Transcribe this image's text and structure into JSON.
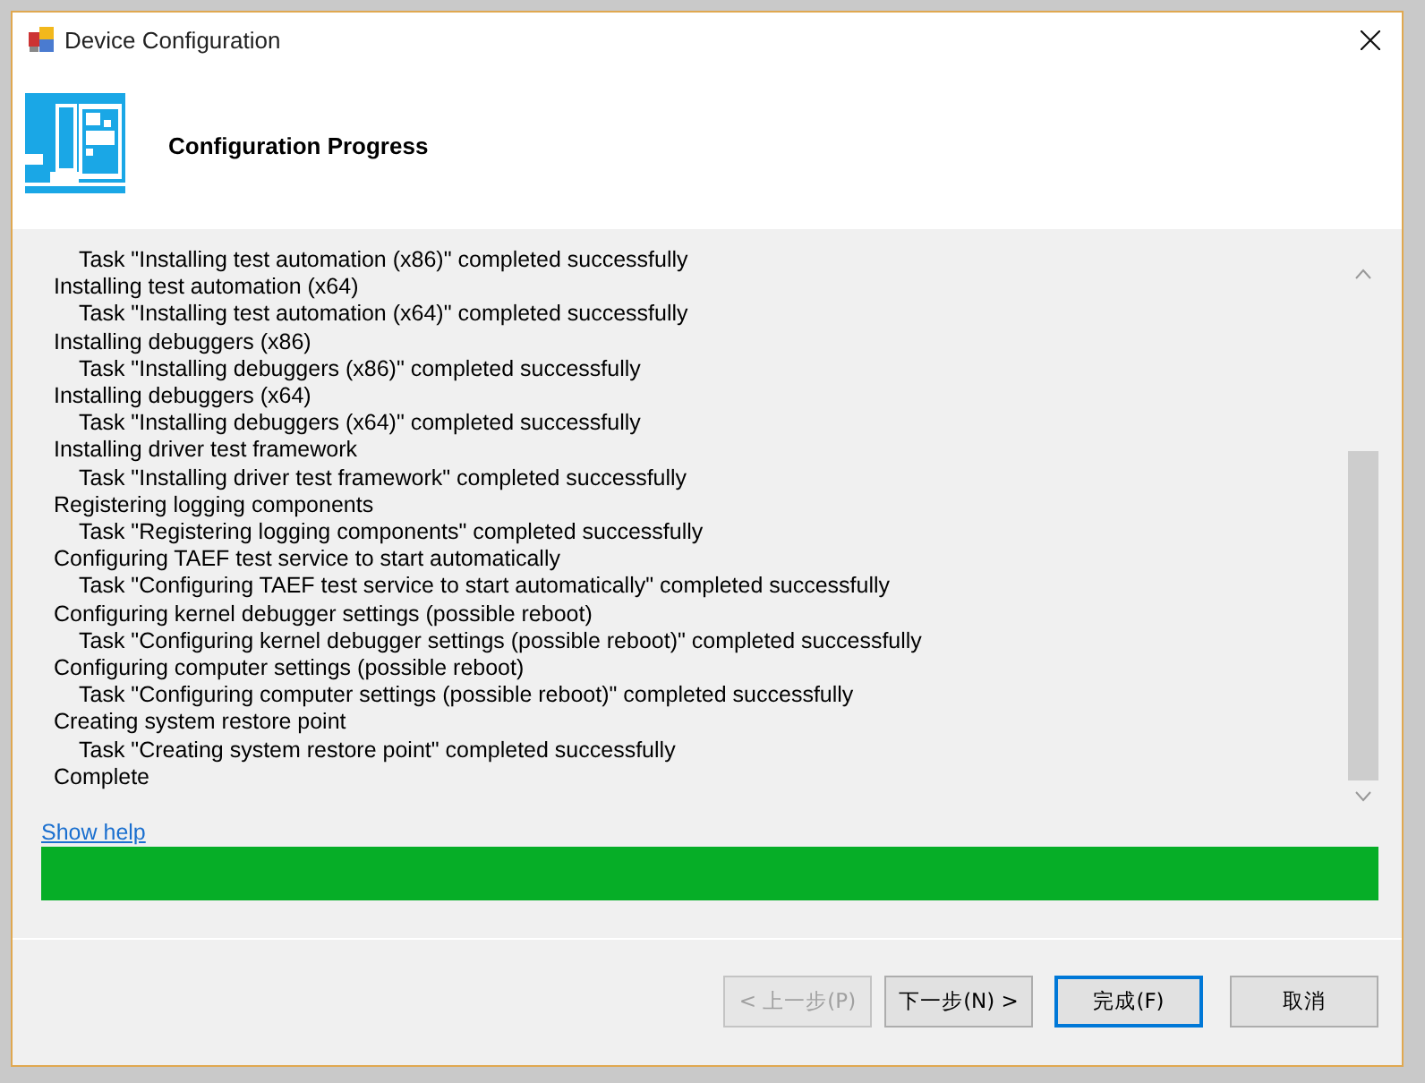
{
  "window": {
    "title": "Device Configuration"
  },
  "header": {
    "title": "Configuration Progress"
  },
  "log": [
    {
      "kind": "task",
      "text": "Task \"Installing test automation (x86)\" completed successfully"
    },
    {
      "kind": "step",
      "text": "Installing test automation (x64)"
    },
    {
      "kind": "task",
      "text": "Task \"Installing test automation (x64)\" completed successfully"
    },
    {
      "kind": "step",
      "text": "Installing debuggers (x86)"
    },
    {
      "kind": "task",
      "text": "Task \"Installing debuggers (x86)\" completed successfully"
    },
    {
      "kind": "step",
      "text": "Installing debuggers (x64)"
    },
    {
      "kind": "task",
      "text": "Task \"Installing debuggers (x64)\" completed successfully"
    },
    {
      "kind": "step",
      "text": "Installing driver test framework"
    },
    {
      "kind": "task",
      "text": "Task \"Installing driver test framework\" completed successfully"
    },
    {
      "kind": "step",
      "text": "Registering logging components"
    },
    {
      "kind": "task",
      "text": "Task \"Registering logging components\" completed successfully"
    },
    {
      "kind": "step",
      "text": "Configuring TAEF test service to start automatically"
    },
    {
      "kind": "task",
      "text": "Task \"Configuring TAEF test service to start automatically\" completed successfully"
    },
    {
      "kind": "step",
      "text": "Configuring kernel debugger settings (possible reboot)"
    },
    {
      "kind": "task",
      "text": "Task \"Configuring kernel debugger settings (possible reboot)\" completed successfully"
    },
    {
      "kind": "step",
      "text": "Configuring computer settings (possible reboot)"
    },
    {
      "kind": "task",
      "text": "Task \"Configuring computer settings (possible reboot)\" completed successfully"
    },
    {
      "kind": "step",
      "text": "Creating system restore point"
    },
    {
      "kind": "task",
      "text": "Task \"Creating system restore point\" completed successfully"
    },
    {
      "kind": "step",
      "text": "Complete"
    }
  ],
  "help_link": "Show help",
  "progress": {
    "level": 1
  },
  "buttons": [
    {
      "label": "< 上一步(P)",
      "disabled": true,
      "default": false
    },
    {
      "label": "下一步(N) >",
      "disabled": false,
      "default": false
    },
    {
      "label": "完成(F)",
      "disabled": false,
      "default": true
    },
    {
      "label": "取消",
      "disabled": false,
      "default": false
    }
  ]
}
